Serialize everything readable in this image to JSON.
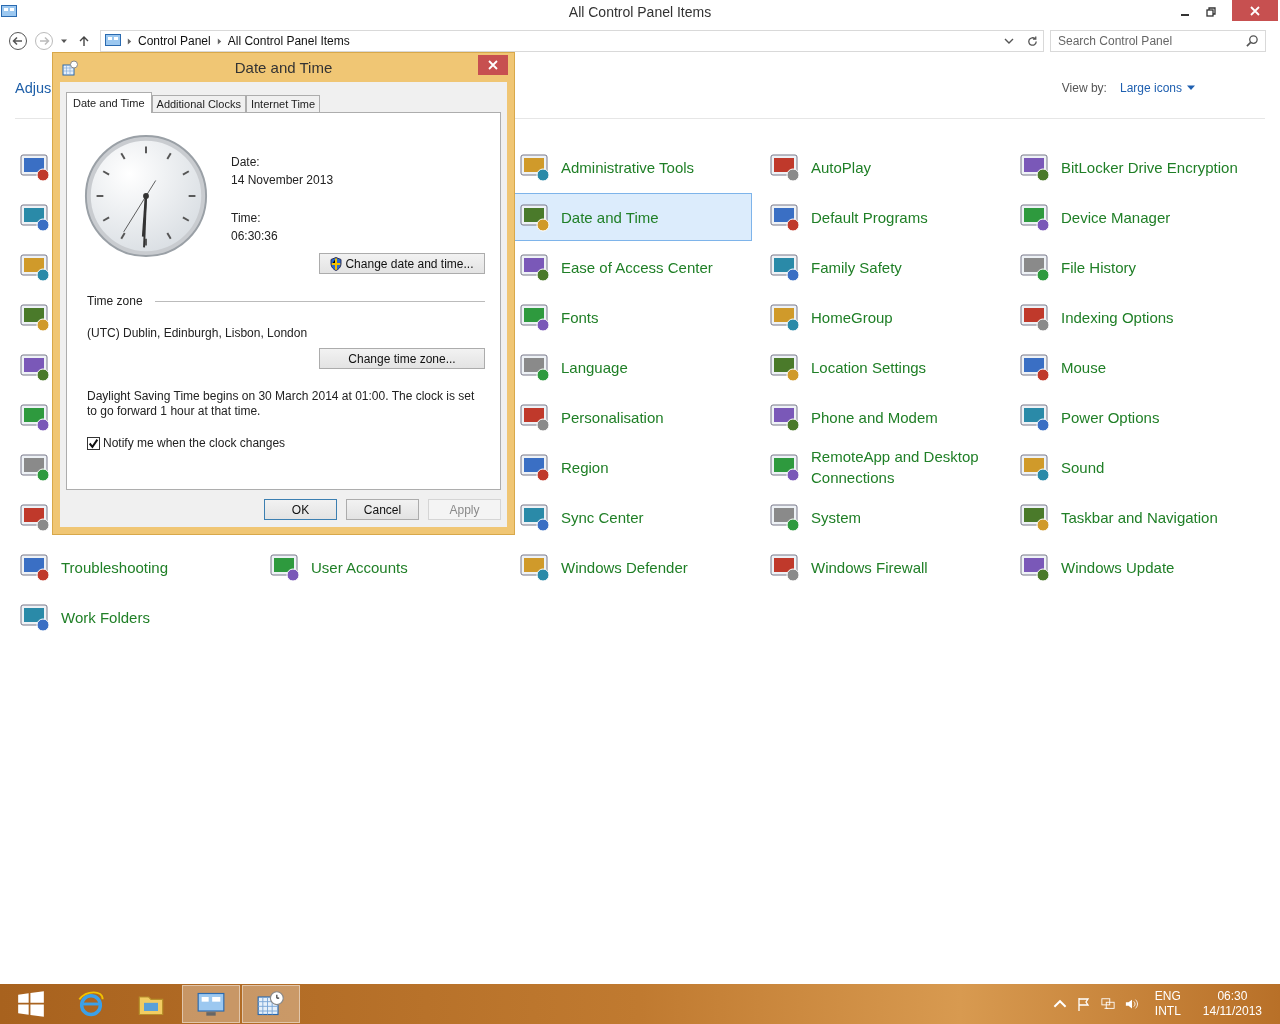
{
  "window": {
    "title": "All Control Panel Items"
  },
  "address_bar": {
    "breadcrumbs": [
      "Control Panel",
      "All Control Panel Items"
    ]
  },
  "search": {
    "placeholder": "Search Control Panel"
  },
  "heading": "Adjus",
  "view_by": {
    "label": "View by:",
    "value": "Large icons"
  },
  "rows": [
    {
      "items": [
        {
          "kind": "icon_only"
        },
        {
          "kind": "covered"
        },
        {
          "kind": "applet",
          "label": "Administrative Tools",
          "selected": false
        },
        {
          "kind": "applet",
          "label": "AutoPlay",
          "selected": false
        },
        {
          "kind": "applet",
          "label": "BitLocker Drive Encryption",
          "selected": false
        }
      ]
    },
    {
      "items": [
        {
          "kind": "icon_only"
        },
        {
          "kind": "covered"
        },
        {
          "kind": "applet",
          "label": "Date and Time",
          "selected": true
        },
        {
          "kind": "applet",
          "label": "Default Programs",
          "selected": false
        },
        {
          "kind": "applet",
          "label": "Device Manager",
          "selected": false
        }
      ]
    },
    {
      "items": [
        {
          "kind": "icon_only"
        },
        {
          "kind": "covered"
        },
        {
          "kind": "applet",
          "label": "Ease of Access Center",
          "selected": false
        },
        {
          "kind": "applet",
          "label": "Family Safety",
          "selected": false
        },
        {
          "kind": "applet",
          "label": "File History",
          "selected": false
        }
      ]
    },
    {
      "items": [
        {
          "kind": "icon_only"
        },
        {
          "kind": "covered"
        },
        {
          "kind": "applet",
          "label": "Fonts",
          "selected": false
        },
        {
          "kind": "applet",
          "label": "HomeGroup",
          "selected": false
        },
        {
          "kind": "applet",
          "label": "Indexing Options",
          "selected": false
        }
      ]
    },
    {
      "items": [
        {
          "kind": "icon_only"
        },
        {
          "kind": "covered"
        },
        {
          "kind": "applet",
          "label": "Language",
          "selected": false
        },
        {
          "kind": "applet",
          "label": "Location Settings",
          "selected": false
        },
        {
          "kind": "applet",
          "label": "Mouse",
          "selected": false
        }
      ]
    },
    {
      "items": [
        {
          "kind": "icon_only"
        },
        {
          "kind": "covered"
        },
        {
          "kind": "applet",
          "label": "Personalisation",
          "selected": false
        },
        {
          "kind": "applet",
          "label": "Phone and Modem",
          "selected": false
        },
        {
          "kind": "applet",
          "label": "Power Options",
          "selected": false
        }
      ]
    },
    {
      "items": [
        {
          "kind": "icon_only"
        },
        {
          "kind": "covered"
        },
        {
          "kind": "applet",
          "label": "Region",
          "selected": false
        },
        {
          "kind": "applet",
          "label": "RemoteApp and Desktop Connections",
          "selected": false
        },
        {
          "kind": "applet",
          "label": "Sound",
          "selected": false
        }
      ]
    },
    {
      "items": [
        {
          "kind": "icon_only"
        },
        {
          "kind": "covered"
        },
        {
          "kind": "applet",
          "label": "Sync Center",
          "selected": false
        },
        {
          "kind": "applet",
          "label": "System",
          "selected": false
        },
        {
          "kind": "applet",
          "label": "Taskbar and Navigation",
          "selected": false
        }
      ]
    },
    {
      "items": [
        {
          "kind": "applet",
          "label": "Troubleshooting",
          "selected": false
        },
        {
          "kind": "applet",
          "label": "User Accounts",
          "selected": false
        },
        {
          "kind": "applet",
          "label": "Windows Defender",
          "selected": false
        },
        {
          "kind": "applet",
          "label": "Windows Firewall",
          "selected": false
        },
        {
          "kind": "applet",
          "label": "Windows Update",
          "selected": false
        }
      ]
    },
    {
      "items": [
        {
          "kind": "applet",
          "label": "Work Folders",
          "selected": false
        }
      ]
    }
  ],
  "dialog": {
    "title": "Date and Time",
    "tabs": [
      {
        "label": "Date and Time",
        "selected": true
      },
      {
        "label": "Additional Clocks",
        "selected": false
      },
      {
        "label": "Internet Time",
        "selected": false
      }
    ],
    "date_label": "Date:",
    "date": "14 November 2013",
    "time_label": "Time:",
    "time": "06:30:36",
    "change_datetime_button": "Change date and time...",
    "time_zone_heading": "Time zone",
    "time_zone": "(UTC) Dublin, Edinburgh, Lisbon, London",
    "change_timezone_button": "Change time zone...",
    "dst_note": "Daylight Saving Time begins on 30 March 2014 at 01:00. The clock is set to go forward 1 hour at that time.",
    "notify": {
      "label": "Notify me when the clock changes",
      "checked": true
    },
    "buttons": [
      {
        "label": "OK",
        "default": true,
        "disabled": false
      },
      {
        "label": "Cancel",
        "default": false,
        "disabled": false
      },
      {
        "label": "Apply",
        "default": false,
        "disabled": true
      }
    ]
  },
  "taskbar": {
    "apps": [
      {
        "kind": "start",
        "selected": false
      },
      {
        "kind": "browser",
        "selected": false
      },
      {
        "kind": "files",
        "selected": false
      },
      {
        "kind": "control_panel",
        "selected": true
      },
      {
        "kind": "clock",
        "selected": true
      }
    ],
    "tray": {
      "language": "ENG",
      "layout": "INTL",
      "time": "06:30",
      "date": "14/11/2013"
    }
  }
}
